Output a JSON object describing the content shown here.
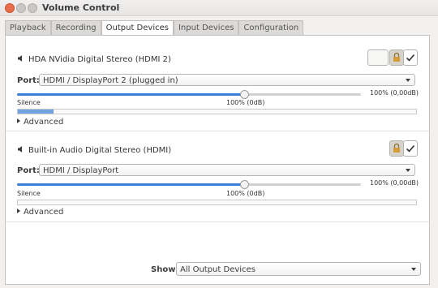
{
  "window": {
    "title": "Volume Control"
  },
  "tabs": [
    {
      "label": "Playback",
      "active": false
    },
    {
      "label": "Recording",
      "active": false
    },
    {
      "label": "Output Devices",
      "active": true
    },
    {
      "label": "Input Devices",
      "active": false
    },
    {
      "label": "Configuration",
      "active": false
    }
  ],
  "devices": [
    {
      "name": "HDA NVidia Digital Stereo (HDMI 2)",
      "port_label": "Port:",
      "port_value": "HDMI / DisplayPort 2 (plugged in)",
      "volume_percent": 100,
      "volume_db_label": "100% (0dB)",
      "volume_right_label": "100% (0,00dB)",
      "silence_label": "Silence",
      "meter_level": 0.09,
      "advanced_label": "Advanced"
    },
    {
      "name": "Built-in Audio Digital Stereo (HDMI)",
      "port_label": "Port:",
      "port_value": "HDMI / DisplayPort",
      "volume_percent": 100,
      "volume_db_label": "100% (0dB)",
      "volume_right_label": "100% (0,00dB)",
      "silence_label": "Silence",
      "meter_level": 0,
      "advanced_label": "Advanced"
    }
  ],
  "footer": {
    "show_label": "Show:",
    "show_value": "All Output Devices"
  },
  "colors": {
    "accent": "#3d7dd8",
    "meter": "#6fa3e3",
    "close": "#e96d4c"
  },
  "icons": [
    "speaker-icon",
    "lock-icon",
    "check-icon",
    "chevron-down-icon",
    "expander-triangle-icon"
  ]
}
